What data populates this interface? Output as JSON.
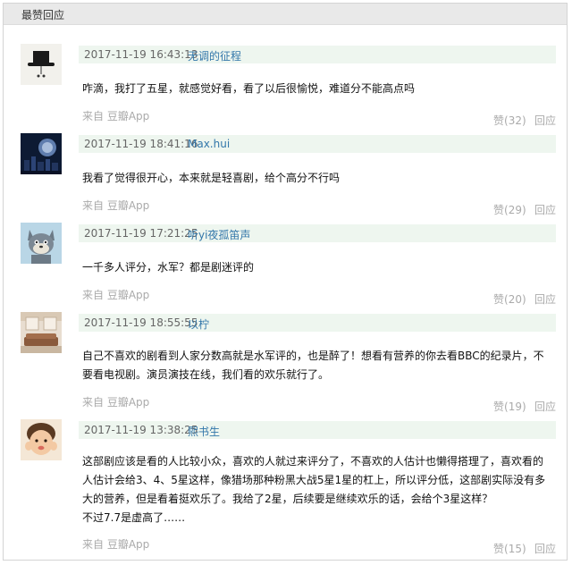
{
  "section": {
    "title": "最赞回应"
  },
  "comments": [
    {
      "time": "2017-11-19 16:43:13",
      "user": "无调的征程",
      "content": "咋滴，我打了五星，就感觉好看，看了以后很愉悦，难道分不能高点吗",
      "source_prefix": "来自",
      "source_app": "豆瓣App",
      "vote_label": "赞",
      "vote_count": "(32)",
      "reply_label": "回应"
    },
    {
      "time": "2017-11-19 18:41:16",
      "user": "Max.hui",
      "content": "我看了觉得很开心，本来就是轻喜剧，给个高分不行吗",
      "source_prefix": "来自",
      "source_app": "豆瓣App",
      "vote_label": "赞",
      "vote_count": "(29)",
      "reply_label": "回应"
    },
    {
      "time": "2017-11-19 17:21:25",
      "user": "听yi夜孤笛声",
      "content": "一千多人评分，水军？都是剧迷评的",
      "source_prefix": "来自",
      "source_app": "豆瓣App",
      "vote_label": "赞",
      "vote_count": "(20)",
      "reply_label": "回应"
    },
    {
      "time": "2017-11-19 18:55:55",
      "user": "以柠",
      "content_lines": [
        "自己不喜欢的剧看到人家分数高就是水军评的，也是醉了！想看有营养的你去看BBC的纪录片，不",
        "要看电视剧。演员演技在线，我们看的欢乐就行了。"
      ],
      "source_prefix": "来自",
      "source_app": "豆瓣App",
      "vote_label": "赞",
      "vote_count": "(19)",
      "reply_label": "回应"
    },
    {
      "time": "2017-11-19 13:38:25",
      "user": "熙书生",
      "content_lines": [
        "这部剧应该是看的人比较小众，喜欢的人就过来评分了，不喜欢的人估计也懒得搭理了，喜欢看的",
        "人估计会给3、4、5星这样，像猎场那种粉黑大战5星1星的杠上，所以评分低，这部剧实际没有多",
        "大的营养，但是看着挺欢乐了。我给了2星，后续要是继续欢乐的话，会给个3星这样？",
        "不过7.7是虚高了……"
      ],
      "source_prefix": "来自",
      "source_app": "豆瓣App",
      "vote_label": "赞",
      "vote_count": "(15)",
      "reply_label": "回应"
    }
  ]
}
